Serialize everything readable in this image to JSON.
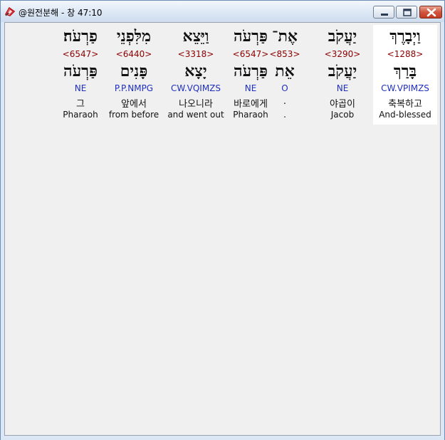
{
  "window": {
    "title": "@원전분해 - 창 47:10",
    "controls": [
      "minimize-icon",
      "maximize-icon",
      "close-icon"
    ]
  },
  "colors": {
    "strong": "#8b0000",
    "morph": "#1f2fbf",
    "highlight": "#ffffff",
    "client_bg": "#f0f0f0"
  },
  "words": [
    {
      "original": "וַיְבָרֶךְ",
      "strong": "<1288>",
      "root": "בָּרַךְ",
      "morph": "CW.VPIMZS",
      "korean": "축복하고",
      "english": "And-blessed",
      "highlighted": true
    },
    {
      "original": "יַעֲקֹב",
      "strong": "<3290>",
      "root": "יַעֲקֹב",
      "morph": "NE",
      "korean": "야곱이",
      "english": "Jacob",
      "highlighted": false
    },
    {
      "original": "אֶת־",
      "strong": "<853>",
      "root": "אֵת",
      "morph": "O",
      "korean": ".",
      "english": ".",
      "highlighted": false
    },
    {
      "original": "פַּרְעֹה",
      "strong": "<6547>",
      "root": "פַּרְעֹה",
      "morph": "NE",
      "korean": "바로에게",
      "english": "Pharaoh",
      "highlighted": false
    },
    {
      "original": "וַיֵּצֵא",
      "strong": "<3318>",
      "root": "יָצָא",
      "morph": "CW.VQIMZS",
      "korean": "나오니라",
      "english": "and went out",
      "highlighted": false
    },
    {
      "original": "מִלִּפְנֵי",
      "strong": "<6440>",
      "root": "פָּנִים",
      "morph": "P.P.NMPG",
      "korean": "앞에서",
      "english": "from before",
      "highlighted": false
    },
    {
      "original": "פַרְעֹה׃",
      "strong": "<6547>",
      "root": "פַּרְעֹה",
      "morph": "NE",
      "korean": "그",
      "english": "Pharaoh",
      "highlighted": false
    }
  ]
}
